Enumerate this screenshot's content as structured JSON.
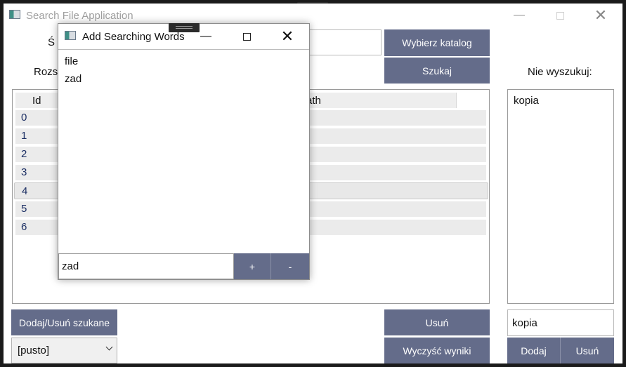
{
  "main_window": {
    "title": "Search File Application",
    "minimize": "—",
    "close": "✕",
    "source_label_partial": "Ś",
    "ext_label_partial": "Rozsz",
    "choose_dir_button": "Wybierz katalog",
    "search_button": "Szukaj",
    "exclude_label": "Nie wyszukuj:",
    "table": {
      "columns": [
        "Id",
        "ath"
      ],
      "rows": [
        "0",
        "1",
        "2",
        "3",
        "4",
        "5",
        "6"
      ],
      "selected_index": 4
    },
    "exclude_list": [
      "kopia"
    ],
    "add_remove_search_button": "Dodaj/Usuń szukane",
    "search_select_value": "[pusto]",
    "remove_button": "Usuń",
    "clear_results_button": "Wyczyść wyniki",
    "exclude_input_value": "kopia",
    "exclude_add_button": "Dodaj",
    "exclude_remove_button": "Usuń"
  },
  "dialog": {
    "title": "Add Searching Words",
    "minimize": "—",
    "close": "✕",
    "words": [
      "file",
      "zad"
    ],
    "input_value": "zad",
    "plus_button": "+",
    "minus_button": "-"
  },
  "icons": {
    "app_icon": "app-icon",
    "minimize": "minimize-icon",
    "maximize": "maximize-icon",
    "close": "close-icon",
    "dropdown": "chevron-down-icon"
  },
  "colors": {
    "button_bg": "#646c8a",
    "row_bg": "#ebebeb",
    "id_text": "#1c2f64"
  }
}
